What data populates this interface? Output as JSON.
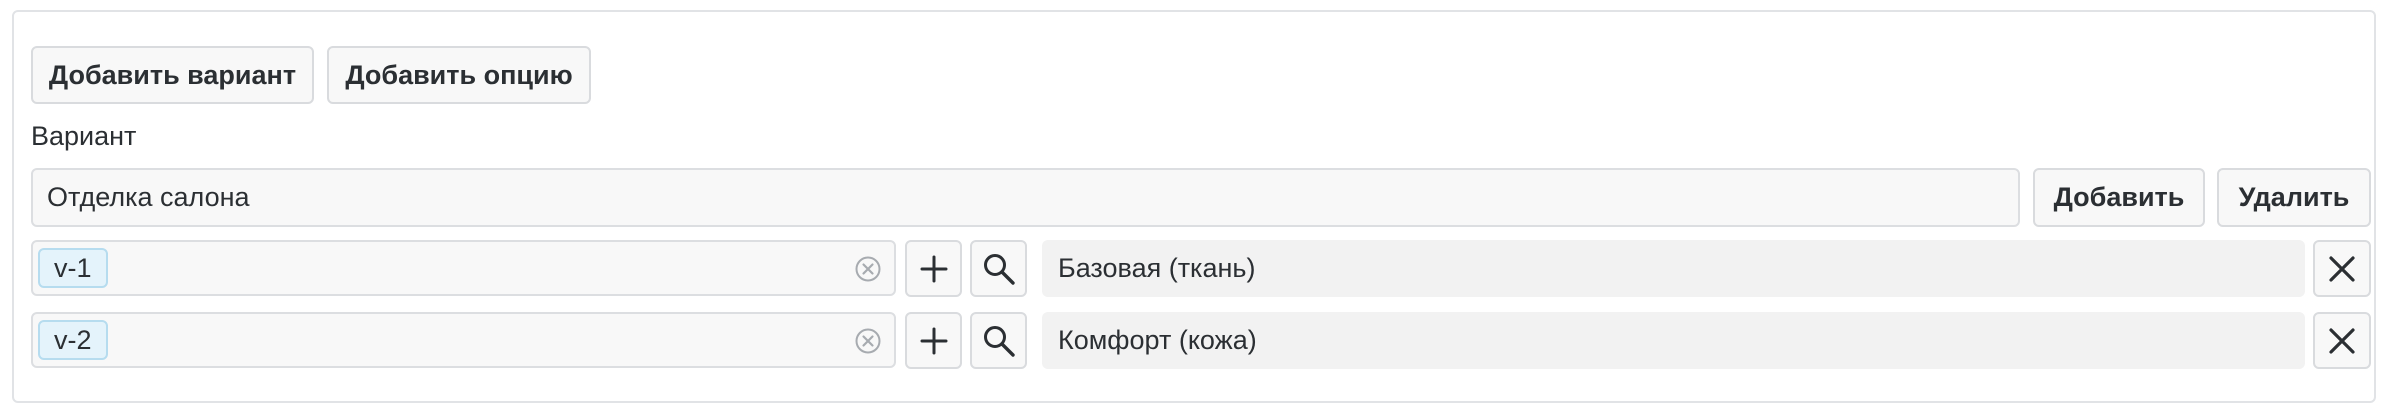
{
  "toolbar": {
    "add_variant_label": "Добавить вариант",
    "add_option_label": "Добавить опцию"
  },
  "variant": {
    "label": "Вариант",
    "name_value": "Отделка салона",
    "add_label": "Добавить",
    "delete_label": "Удалить"
  },
  "options": [
    {
      "tag": "v-1",
      "value": "Базовая (ткань)"
    },
    {
      "tag": "v-2",
      "value": "Комфорт (кожа)"
    }
  ],
  "icons": {
    "clear": "circle-x-icon",
    "add": "plus-icon",
    "search": "magnifier-icon",
    "remove": "close-icon"
  }
}
